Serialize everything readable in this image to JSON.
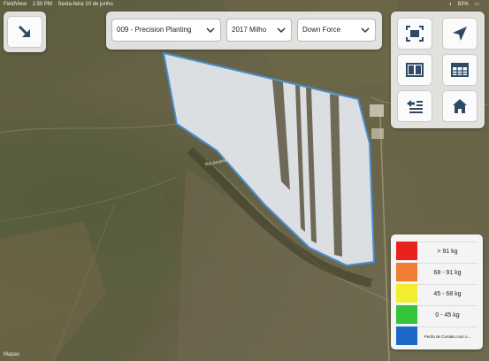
{
  "status_bar": {
    "app": "FieldView",
    "time": "1:50 PM",
    "date": "Sexta-feira 10 de junho",
    "battery": "82%"
  },
  "toolbar": {
    "field_select": {
      "value": "009 - Precision Planting"
    },
    "season_select": {
      "value": "2017 Milho"
    },
    "layer_select": {
      "value": "Down Force"
    }
  },
  "buttons": {
    "collapse": {
      "icon": "arrow-down-right-icon"
    },
    "fit_bounds": {
      "icon": "fit-bounds-icon"
    },
    "locate": {
      "icon": "location-arrow-icon"
    },
    "split_view": {
      "icon": "split-view-icon"
    },
    "table_view": {
      "icon": "table-icon"
    },
    "layers_list": {
      "icon": "list-back-icon"
    },
    "home": {
      "icon": "home-icon"
    }
  },
  "legend": {
    "items": [
      {
        "label": "> 91 kg",
        "color": "#e8231b"
      },
      {
        "label": "68 - 91 kg",
        "color": "#f07d34"
      },
      {
        "label": "45 - 68 kg",
        "color": "#f2ee2e"
      },
      {
        "label": "0 - 45 kg",
        "color": "#35c33a"
      },
      {
        "label": "Perda de Contato com o...",
        "color": "#1c68c8"
      }
    ]
  },
  "map": {
    "field_label": "Rio Acuera",
    "attribution": "Mapas"
  },
  "colors": {
    "field_fill": "#dcdfe2",
    "field_border": "#4a8fd0",
    "button_icon": "#2f4a66"
  }
}
